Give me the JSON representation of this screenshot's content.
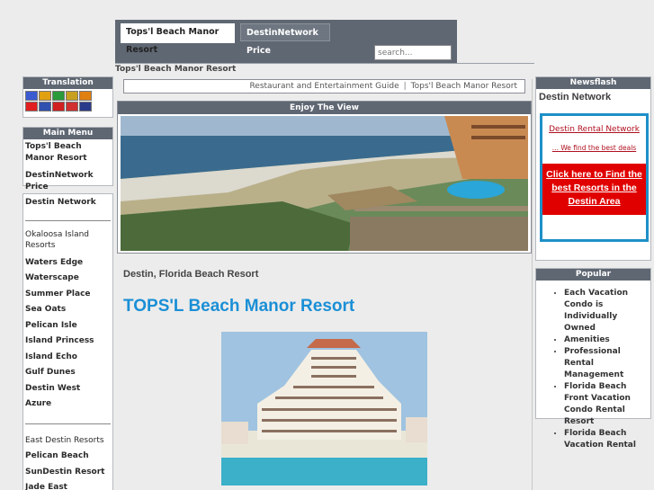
{
  "tabs": {
    "active": "Tops'l Beach Manor Resort",
    "inactive": "DestinNetwork Price"
  },
  "search": {
    "placeholder": "search..."
  },
  "breadcrumb": "Tops'l Beach Manor Resort",
  "translation": {
    "heading": "Translation",
    "flags": [
      {
        "name": "french-flag-icon",
        "color": "#3b5bd1"
      },
      {
        "name": "german-flag-icon",
        "color": "#e0a010"
      },
      {
        "name": "italian-flag-icon",
        "color": "#2a9a3a"
      },
      {
        "name": "portuguese-flag-icon",
        "color": "#c8a020"
      },
      {
        "name": "spanish-flag-icon",
        "color": "#e08010"
      },
      {
        "name": "japanese-flag-icon",
        "color": "#e02020"
      },
      {
        "name": "korean-flag-icon",
        "color": "#3050b0"
      },
      {
        "name": "chinese-flag-icon",
        "color": "#d02020"
      },
      {
        "name": "russian-flag-icon",
        "color": "#d03030"
      },
      {
        "name": "english-flag-icon",
        "color": "#2a3a8a"
      }
    ]
  },
  "main_menu": {
    "heading": "Main Menu",
    "items": [
      "Tops'l Beach Manor Resort",
      "DestinNetwork Price"
    ]
  },
  "side_links": {
    "top": "Destin Network",
    "group1": [
      "Okaloosa Island Resorts",
      "Waters Edge",
      "Waterscape",
      "Summer Place",
      "Sea Oats",
      "Pelican Isle",
      "Island Princess",
      "Island Echo",
      "Gulf Dunes",
      "Destin West",
      "Azure"
    ],
    "group2": [
      "East Destin Resorts",
      "Pelican Beach",
      "SunDestin Resort",
      "Jade East"
    ]
  },
  "subnav": {
    "link1": "Restaurant and Entertainment Guide",
    "separator": "|",
    "link2": "Tops'l Beach Manor Resort"
  },
  "view": {
    "heading": "Enjoy The View"
  },
  "content": {
    "tagline": "Destin, Florida Beach Resort",
    "title": "TOPS'L Beach Manor Resort"
  },
  "newsflash": {
    "heading": "Newsflash",
    "subtitle": "Destin Network",
    "promo_link": "Destin Rental Network",
    "promo_sub": "... We find the best deals",
    "promo_button": "Click here to Find the best Resorts in the Destin Area"
  },
  "popular": {
    "heading": "Popular",
    "items": [
      "Each Vacation Condo is Individually Owned",
      "Amenities",
      "Professional Rental Management",
      "Florida Beach Front Vacation Condo Rental Resort",
      "Florida Beach Vacation Rental"
    ]
  },
  "colors": {
    "header_bg": "#5f6773",
    "title_blue": "#1a8fd6",
    "promo_red": "#e00000",
    "promo_border": "#1e90c8"
  }
}
